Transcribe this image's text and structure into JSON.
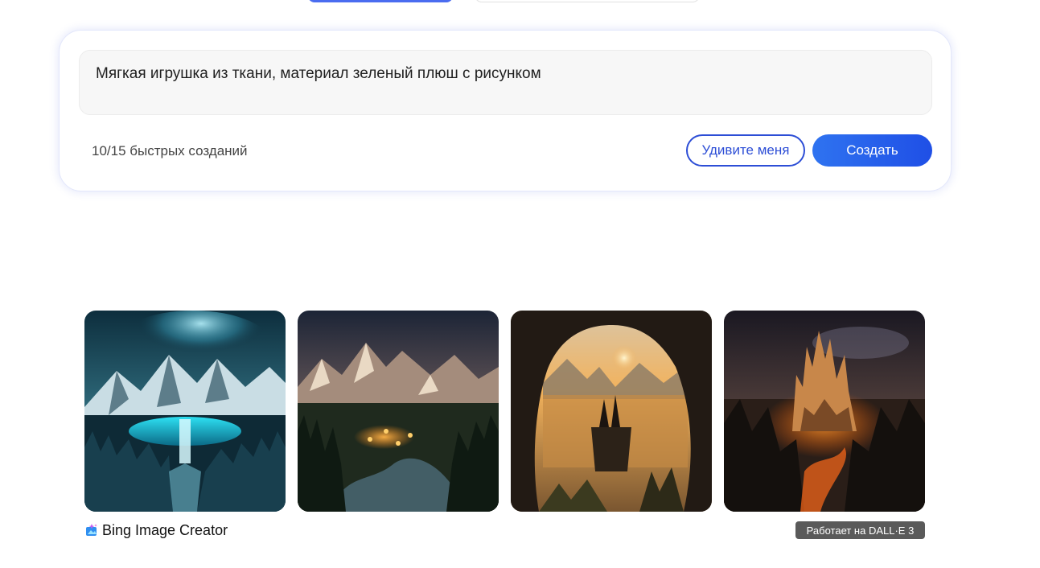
{
  "prompt": {
    "text": "Мягкая игрушка из ткани, материал зеленый плюш с рисунком"
  },
  "boosts": {
    "label": "10/15 быстрых созданий"
  },
  "actions": {
    "surprise_label": "Удивите меня",
    "create_label": "Создать"
  },
  "gallery": {
    "images": [
      {
        "name": "waterfall-mountain-aurora"
      },
      {
        "name": "mountain-village-river"
      },
      {
        "name": "cave-lake-sunset"
      },
      {
        "name": "lava-castle-mountains"
      }
    ]
  },
  "footer": {
    "brand": "Bing Image Creator",
    "powered_by": "Работает на DALL·E 3"
  },
  "colors": {
    "accent": "#2d4ed6",
    "create_button": "#1f4fe6",
    "badge_bg": "#5a5a5a"
  }
}
